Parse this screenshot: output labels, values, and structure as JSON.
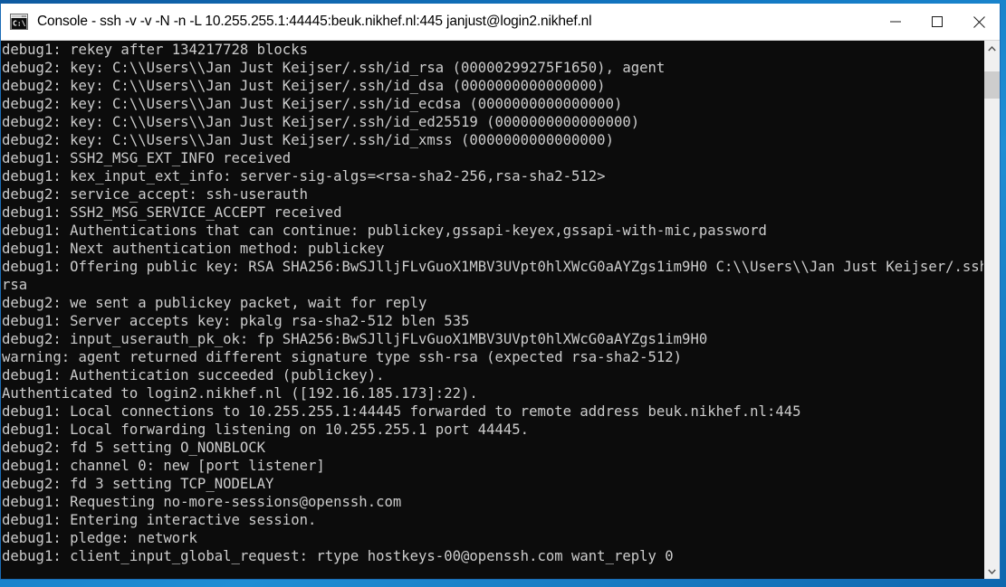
{
  "window": {
    "title": "Console - ssh  -v -v -N -n -L 10.255.255.1:44445:beuk.nikhef.nl:445 janjust@login2.nikhef.nl",
    "icon": "console-icon",
    "controls": {
      "minimize_label": "Minimize",
      "maximize_label": "Maximize",
      "close_label": "Close"
    }
  },
  "terminal": {
    "foreground_color": "#cccccc",
    "background_color": "#0c0c0c",
    "lines": [
      "debug1: rekey after 134217728 blocks",
      "debug2: key: C:\\\\Users\\\\Jan Just Keijser/.ssh/id_rsa (00000299275F1650), agent",
      "debug2: key: C:\\\\Users\\\\Jan Just Keijser/.ssh/id_dsa (0000000000000000)",
      "debug2: key: C:\\\\Users\\\\Jan Just Keijser/.ssh/id_ecdsa (0000000000000000)",
      "debug2: key: C:\\\\Users\\\\Jan Just Keijser/.ssh/id_ed25519 (0000000000000000)",
      "debug2: key: C:\\\\Users\\\\Jan Just Keijser/.ssh/id_xmss (0000000000000000)",
      "debug1: SSH2_MSG_EXT_INFO received",
      "debug1: kex_input_ext_info: server-sig-algs=<rsa-sha2-256,rsa-sha2-512>",
      "debug2: service_accept: ssh-userauth",
      "debug1: SSH2_MSG_SERVICE_ACCEPT received",
      "debug1: Authentications that can continue: publickey,gssapi-keyex,gssapi-with-mic,password",
      "debug1: Next authentication method: publickey",
      "debug1: Offering public key: RSA SHA256:BwSJlljFLvGuoX1MBV3UVpt0hlXWcG0aAYZgs1im9H0 C:\\\\Users\\\\Jan Just Keijser/.ssh/id_",
      "rsa",
      "debug2: we sent a publickey packet, wait for reply",
      "debug1: Server accepts key: pkalg rsa-sha2-512 blen 535",
      "debug2: input_userauth_pk_ok: fp SHA256:BwSJlljFLvGuoX1MBV3UVpt0hlXWcG0aAYZgs1im9H0",
      "warning: agent returned different signature type ssh-rsa (expected rsa-sha2-512)",
      "debug1: Authentication succeeded (publickey).",
      "Authenticated to login2.nikhef.nl ([192.16.185.173]:22).",
      "debug1: Local connections to 10.255.255.1:44445 forwarded to remote address beuk.nikhef.nl:445",
      "debug1: Local forwarding listening on 10.255.255.1 port 44445.",
      "debug2: fd 5 setting O_NONBLOCK",
      "debug1: channel 0: new [port listener]",
      "debug2: fd 3 setting TCP_NODELAY",
      "debug1: Requesting no-more-sessions@openssh.com",
      "debug1: Entering interactive session.",
      "debug1: pledge: network",
      "debug1: client_input_global_request: rtype hostkeys-00@openssh.com want_reply 0"
    ]
  },
  "scrollbar": {
    "up_arrow": "chevron-up-icon",
    "down_arrow": "chevron-down-icon",
    "thumb_label": "scroll-thumb"
  }
}
